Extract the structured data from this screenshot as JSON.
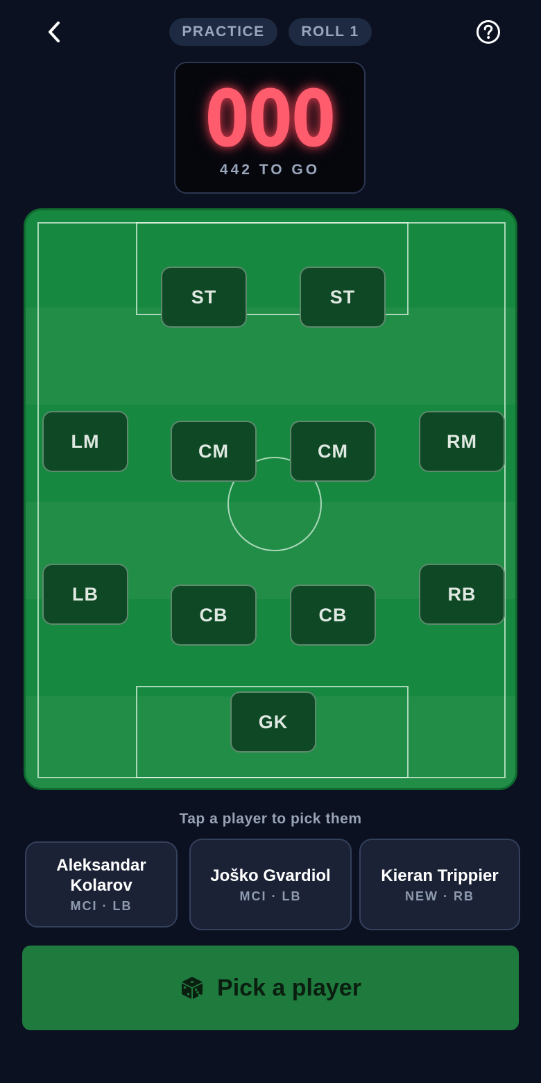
{
  "header": {
    "mode_badge": "PRACTICE",
    "roll_badge": "ROLL 1"
  },
  "scoreboard": {
    "digits": "000",
    "remaining": "442 TO GO"
  },
  "formation": {
    "positions": [
      "ST",
      "ST",
      "LM",
      "CM",
      "CM",
      "RM",
      "LB",
      "CB",
      "CB",
      "RB",
      "GK"
    ]
  },
  "picker": {
    "hint": "Tap a player to pick them",
    "options": [
      {
        "name_line1": "Aleksandar",
        "name_line2": "Kolarov",
        "meta": "MCI · LB"
      },
      {
        "name_line1": "Joško Gvardiol",
        "name_line2": "",
        "meta": "MCI · LB"
      },
      {
        "name_line1": "Kieran Trippier",
        "name_line2": "",
        "meta": "NEW · RB"
      }
    ]
  },
  "action": {
    "label": "Pick a player",
    "icon": "dice-icon"
  },
  "colors": {
    "background": "#0b1120",
    "pitch": "#17883f",
    "score": "#ff5c6e",
    "cta": "#1f7a3d"
  }
}
